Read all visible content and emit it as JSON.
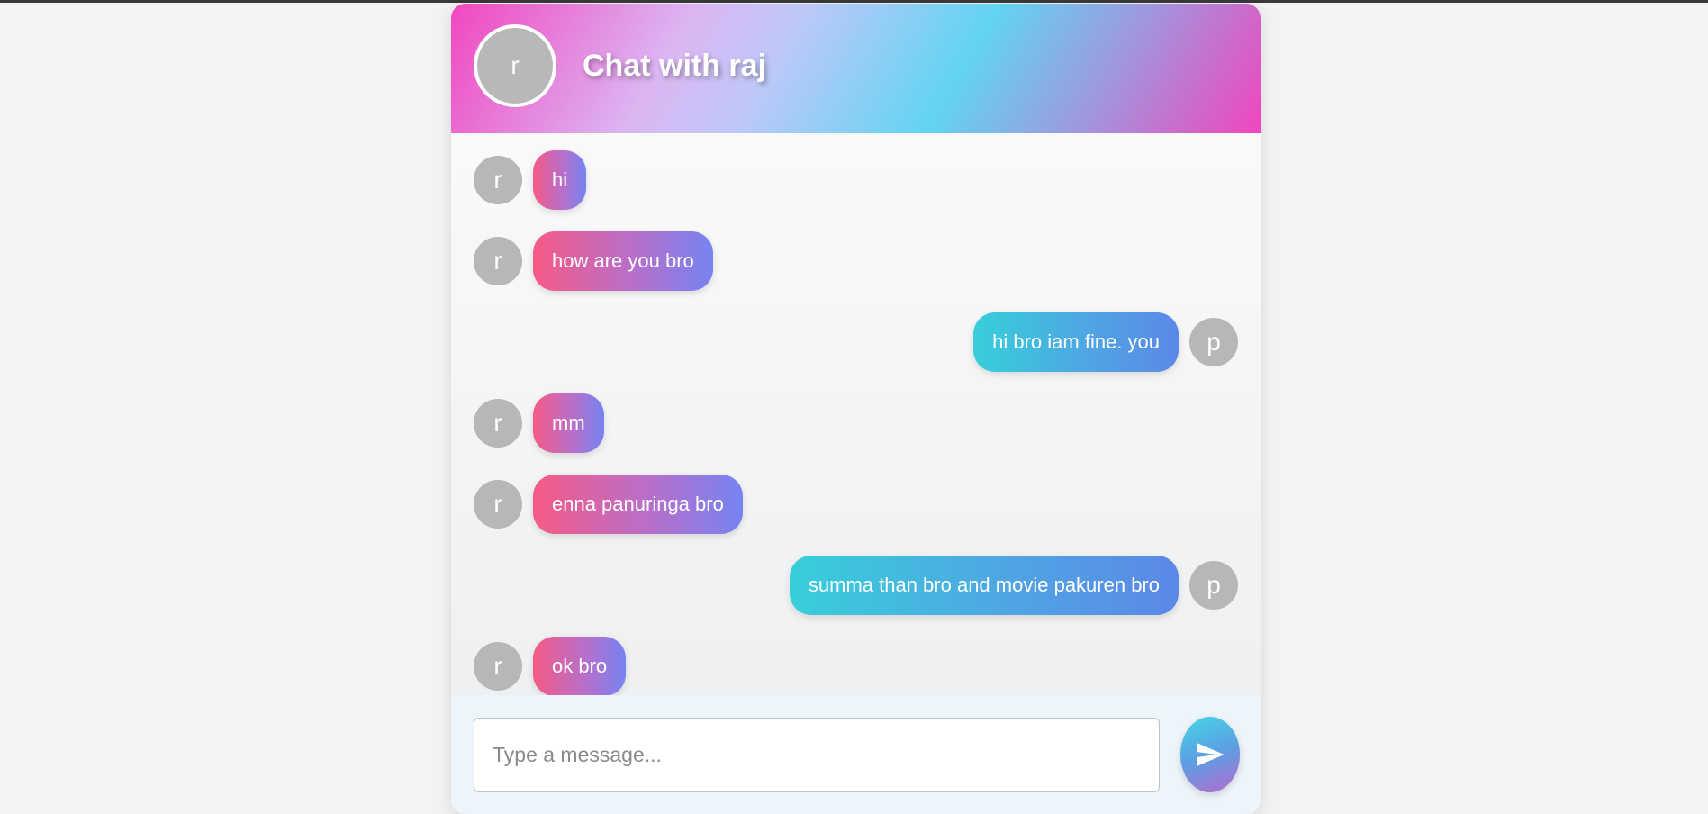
{
  "header": {
    "avatar_letter": "r",
    "title": "Chat with raj"
  },
  "messages": [
    {
      "sender": "them",
      "avatar": "r",
      "text": "hi"
    },
    {
      "sender": "them",
      "avatar": "r",
      "text": "how are you bro"
    },
    {
      "sender": "me",
      "avatar": "p",
      "text": "hi bro iam fine. you"
    },
    {
      "sender": "them",
      "avatar": "r",
      "text": "mm"
    },
    {
      "sender": "them",
      "avatar": "r",
      "text": "enna panuringa bro"
    },
    {
      "sender": "me",
      "avatar": "p",
      "text": "summa than bro and movie pakuren bro"
    },
    {
      "sender": "them",
      "avatar": "r",
      "text": "ok bro"
    }
  ],
  "composer": {
    "placeholder": "Type a message...",
    "value": "",
    "send_icon": "send-icon"
  },
  "colors": {
    "them_bubble_start": "#f65a86",
    "them_bubble_end": "#7683f2",
    "me_bubble_start": "#37cfda",
    "me_bubble_end": "#5b88e8",
    "avatar_gray": "#b7b7b7"
  }
}
